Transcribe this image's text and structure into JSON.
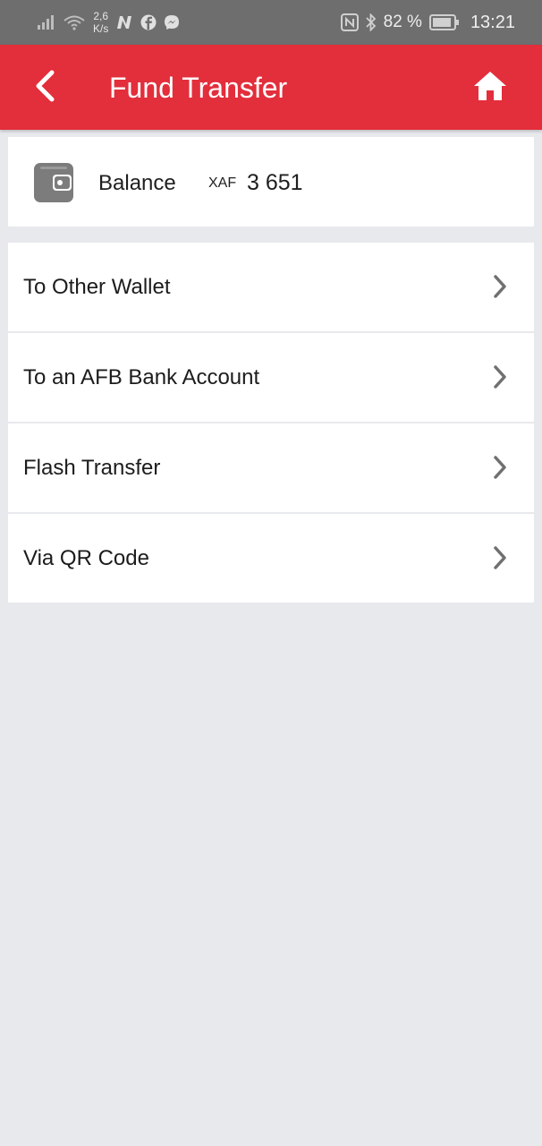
{
  "status_bar": {
    "speed_value": "2,6",
    "speed_unit": "K/s",
    "battery_percent": "82 %",
    "time": "13:21",
    "icons": [
      "signal-icon",
      "wifi-icon",
      "n-app-icon",
      "facebook-icon",
      "messenger-icon",
      "nfc-icon",
      "bluetooth-icon",
      "battery-icon"
    ]
  },
  "header": {
    "title": "Fund Transfer",
    "back_icon": "back-arrow-icon",
    "home_icon": "home-icon",
    "color": "#e32e3b"
  },
  "balance": {
    "label": "Balance",
    "currency": "XAF",
    "amount": "3 651",
    "icon": "wallet-icon"
  },
  "menu": {
    "items": [
      {
        "label": "To Other Wallet"
      },
      {
        "label": "To an AFB Bank Account"
      },
      {
        "label": "Flash Transfer"
      },
      {
        "label": "Via QR Code"
      }
    ],
    "chevron_icon": "chevron-right-icon"
  }
}
